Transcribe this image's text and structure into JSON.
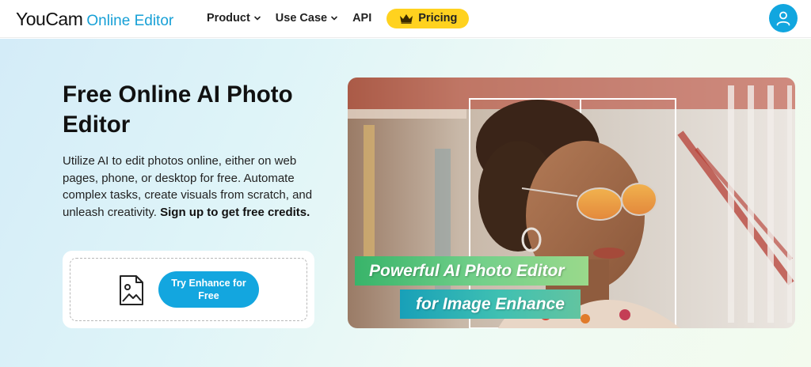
{
  "header": {
    "logo_brand": "YouCam",
    "logo_sub": "Online Editor",
    "nav": [
      {
        "label": "Product",
        "has_dropdown": true
      },
      {
        "label": "Use Case",
        "has_dropdown": true
      },
      {
        "label": "API",
        "has_dropdown": false
      }
    ],
    "pricing_label": "Pricing",
    "icons": {
      "crown": "crown-icon",
      "profile": "user-icon",
      "dropdown": "chevron-down-icon"
    }
  },
  "hero": {
    "title": "Free Online AI Photo Editor",
    "description": "Utilize AI to edit photos online, either on web pages, phone, or desktop for free. Automate complex tasks, create visuals from scratch, and unleash creativity.",
    "description_cta": "Sign up to get free credits.",
    "upload_icon": "image-file-icon",
    "try_button_label": "Try Enhance for Free"
  },
  "banner": {
    "tag_line_1": "Powerful AI Photo Editor",
    "tag_line_2": "for Image Enhance"
  },
  "colors": {
    "brand_blue": "#13a6df",
    "pricing_yellow": "#ffd21f",
    "tag_green": "#4cc06e",
    "tag_teal": "#22a8b8"
  }
}
